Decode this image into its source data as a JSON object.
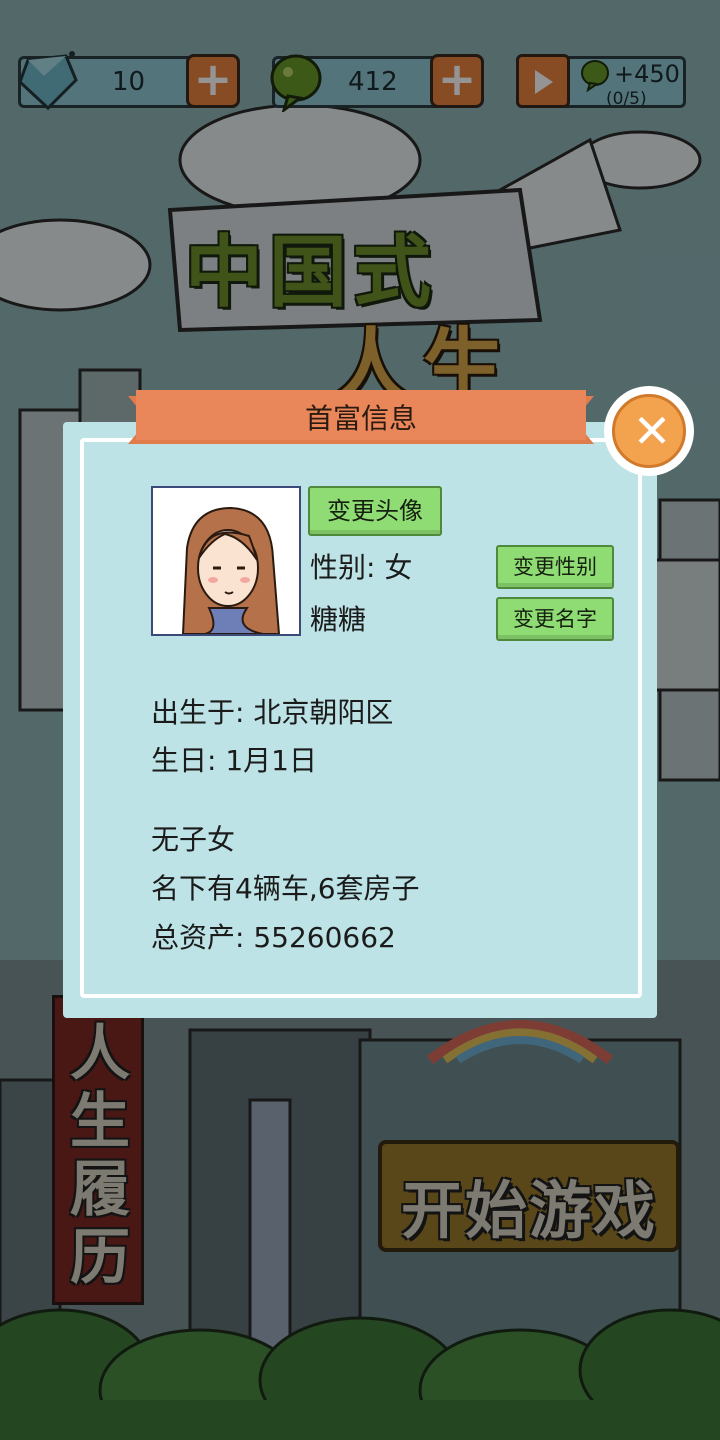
{
  "resources": {
    "gems": "10",
    "coins": "412",
    "bonus": "+450",
    "bonus_progress": "(0/5)",
    "gem_icon": "diamond-icon",
    "coin_icon": "green-bubble-icon",
    "video_icon": "video-play-icon"
  },
  "title": {
    "line1": "中国式",
    "line2": "人生"
  },
  "side_banner": "人生履历",
  "start_button": "开始游戏",
  "modal": {
    "title": "首富信息",
    "change_avatar": "变更头像",
    "gender": "性别: 女",
    "change_gender": "变更性别",
    "name": "糖糖",
    "change_name": "变更名字",
    "birthplace": "出生于: 北京朝阳区",
    "birthday": "生日: 1月1日",
    "children": "无子女",
    "property": "名下有4辆车,6套房子",
    "assets": "总资产:  55260662"
  },
  "colors": {
    "modal_bg": "#bde3e6",
    "ribbon": "#e07b4c",
    "button_green": "#8fdc74",
    "close_orange": "#f3a24e"
  }
}
